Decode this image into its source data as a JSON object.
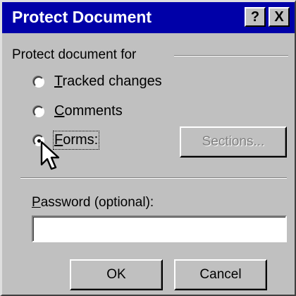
{
  "window": {
    "title": "Protect Document",
    "help_glyph": "?",
    "close_glyph": "X"
  },
  "protect_group": {
    "label": "Protect document for",
    "options": [
      {
        "accel": "T",
        "rest": "racked changes",
        "checked": false
      },
      {
        "accel": "C",
        "rest": "omments",
        "checked": false
      },
      {
        "accel": "F",
        "rest": "orms:",
        "checked": true
      }
    ]
  },
  "buttons": {
    "sections": "Sections...",
    "ok": "OK",
    "cancel": "Cancel"
  },
  "password": {
    "label": "Password (optional):",
    "value": ""
  },
  "icons": {
    "cursor": "mouse-pointer-icon"
  },
  "colors": {
    "titlebar": "#0000a8",
    "face": "#c0c0c0"
  }
}
